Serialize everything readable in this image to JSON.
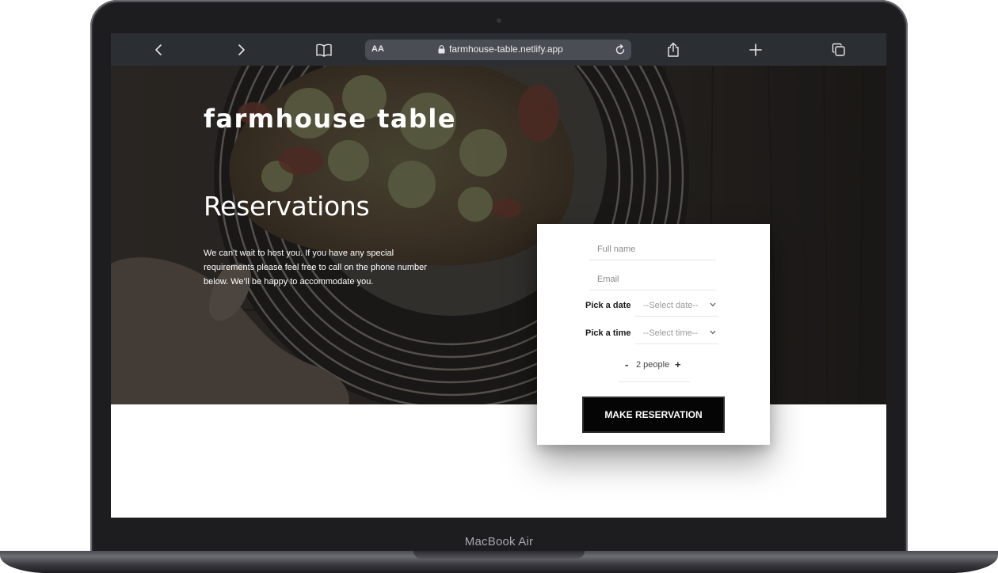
{
  "device": {
    "label": "MacBook Air"
  },
  "browser": {
    "text_size_label": "AA",
    "url": "farmhouse-table.netlify.app",
    "icons": {
      "back": "chevron-left-icon",
      "forward": "chevron-right-icon",
      "bookmarks": "book-icon",
      "secure": "lock-icon",
      "reload": "reload-icon",
      "share": "share-icon",
      "new_tab": "plus-icon",
      "tabs": "tabs-icon"
    }
  },
  "site": {
    "brand": "farmhouse table",
    "heading": "Reservations",
    "intro": "We can’t wait to host you. If you have any special requirements please feel free to call on the phone number below. We’ll be happy to accommodate you."
  },
  "form": {
    "full_name_placeholder": "Full name",
    "email_placeholder": "Email",
    "date_label": "Pick a date",
    "date_placeholder": "--Select date--",
    "time_label": "Pick a time",
    "time_placeholder": "--Select time--",
    "decrement_label": "-",
    "people_text": "2 people",
    "increment_label": "+",
    "submit_label": "MAKE RESERVATION"
  },
  "colors": {
    "toolbar_bg": "#2b2e33",
    "button_bg": "#050505",
    "hero_overlay": "#1a1816",
    "page_bg": "#ffffff"
  }
}
